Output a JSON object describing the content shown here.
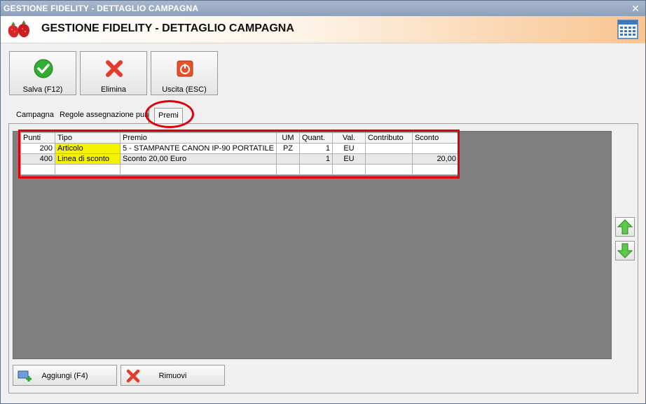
{
  "window": {
    "title": "GESTIONE FIDELITY - DETTAGLIO CAMPAGNA",
    "close_glyph": "✕"
  },
  "header": {
    "title": "GESTIONE FIDELITY - DETTAGLIO CAMPAGNA",
    "logo_icon": "strawberry-logo",
    "calendar_icon": "calendar-icon"
  },
  "toolbar": {
    "save_label": "Salva (F12)",
    "delete_label": "Elimina",
    "exit_label": "Uscita (ESC)"
  },
  "tabs": [
    {
      "label": "Campagna"
    },
    {
      "label": "Regole assegnazione punti"
    },
    {
      "label": "Premi"
    }
  ],
  "grid": {
    "columns": [
      "Punti",
      "Tipo",
      "Premio",
      "UM",
      "Quant.",
      "Val.",
      "Contributo",
      "Sconto"
    ],
    "rows": [
      {
        "punti": "200",
        "tipo": "Articolo",
        "premio": "5 - STAMPANTE CANON IP-90 PORTATILE",
        "um": "PZ",
        "quant": "1",
        "val": "EU",
        "contributo": "",
        "sconto": ""
      },
      {
        "punti": "400",
        "tipo": "Linea di sconto",
        "premio": "Sconto 20,00 Euro",
        "um": "",
        "quant": "1",
        "val": "EU",
        "contributo": "",
        "sconto": "20,00"
      }
    ]
  },
  "bottom": {
    "add_label": "Aggiungi (F4)",
    "remove_label": "Rimuovi"
  },
  "colors": {
    "highlight": "#e0000a",
    "type_cell": "#f5f200",
    "header_orange": "#f9c48f"
  }
}
